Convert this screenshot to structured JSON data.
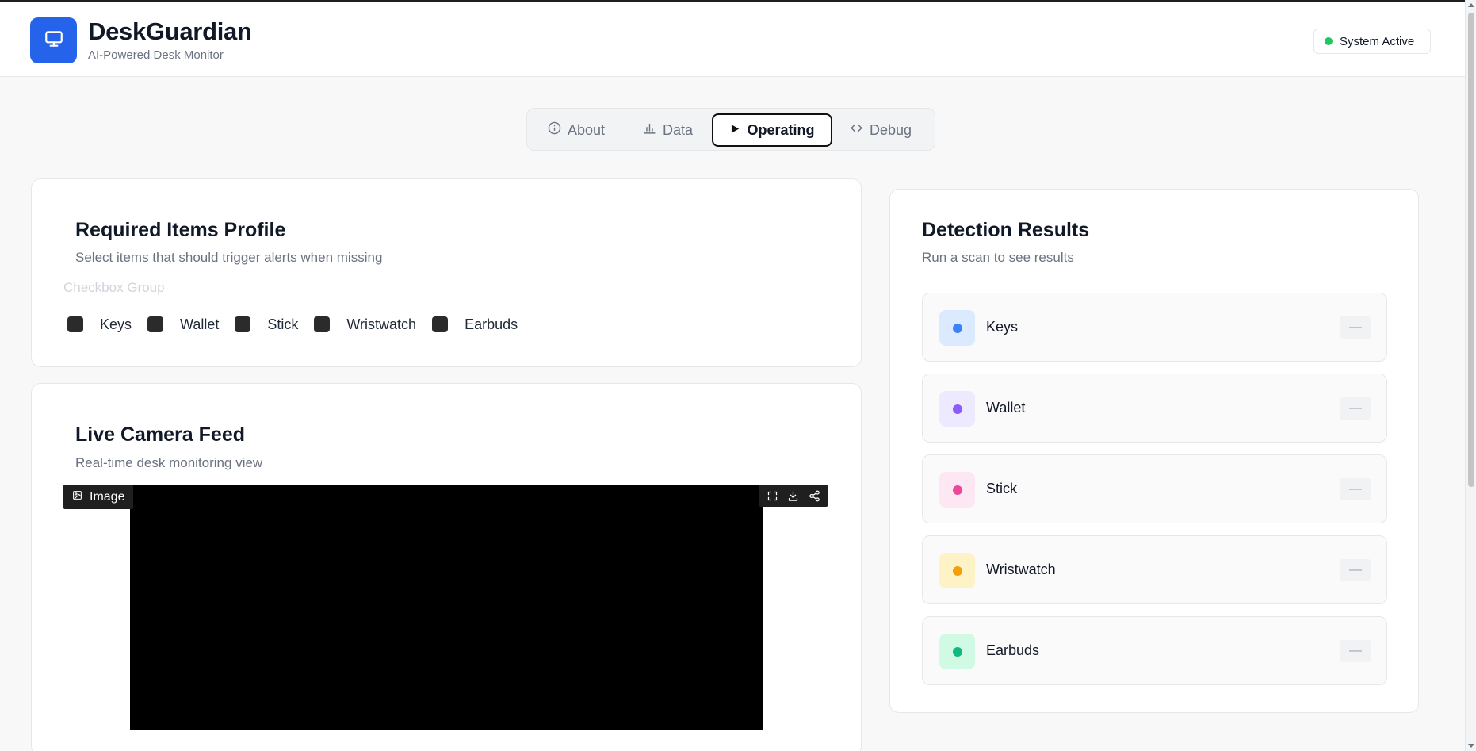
{
  "app": {
    "title": "DeskGuardian",
    "subtitle": "AI-Powered Desk Monitor",
    "logo_icon": "monitor-icon",
    "brand_color": "#2563eb"
  },
  "status": {
    "label": "System Active",
    "color": "#22c55e"
  },
  "tabs": [
    {
      "label": "About",
      "icon": "info-icon",
      "active": false
    },
    {
      "label": "Data",
      "icon": "bar-chart-icon",
      "active": false
    },
    {
      "label": "Operating",
      "icon": "play-icon",
      "active": true
    },
    {
      "label": "Debug",
      "icon": "code-icon",
      "active": false
    }
  ],
  "profile": {
    "title": "Required Items Profile",
    "subtitle": "Select items that should trigger alerts when missing",
    "group_label": "Checkbox Group",
    "items": [
      "Keys",
      "Wallet",
      "Stick",
      "Wristwatch",
      "Earbuds"
    ]
  },
  "camera": {
    "title": "Live Camera Feed",
    "subtitle": "Real-time desk monitoring view",
    "image_label": "Image",
    "tools": [
      "fullscreen-icon",
      "download-icon",
      "share-icon"
    ]
  },
  "detection": {
    "title": "Detection Results",
    "subtitle": "Run a scan to see results",
    "items": [
      {
        "label": "Keys",
        "status": "—",
        "dot": "#3b82f6",
        "bg": "#dbeafe"
      },
      {
        "label": "Wallet",
        "status": "—",
        "dot": "#8b5cf6",
        "bg": "#ede9fe"
      },
      {
        "label": "Stick",
        "status": "—",
        "dot": "#ec4899",
        "bg": "#fce7f3"
      },
      {
        "label": "Wristwatch",
        "status": "—",
        "dot": "#f59e0b",
        "bg": "#fef3c7"
      },
      {
        "label": "Earbuds",
        "status": "—",
        "dot": "#10b981",
        "bg": "#d1fae5"
      }
    ]
  }
}
